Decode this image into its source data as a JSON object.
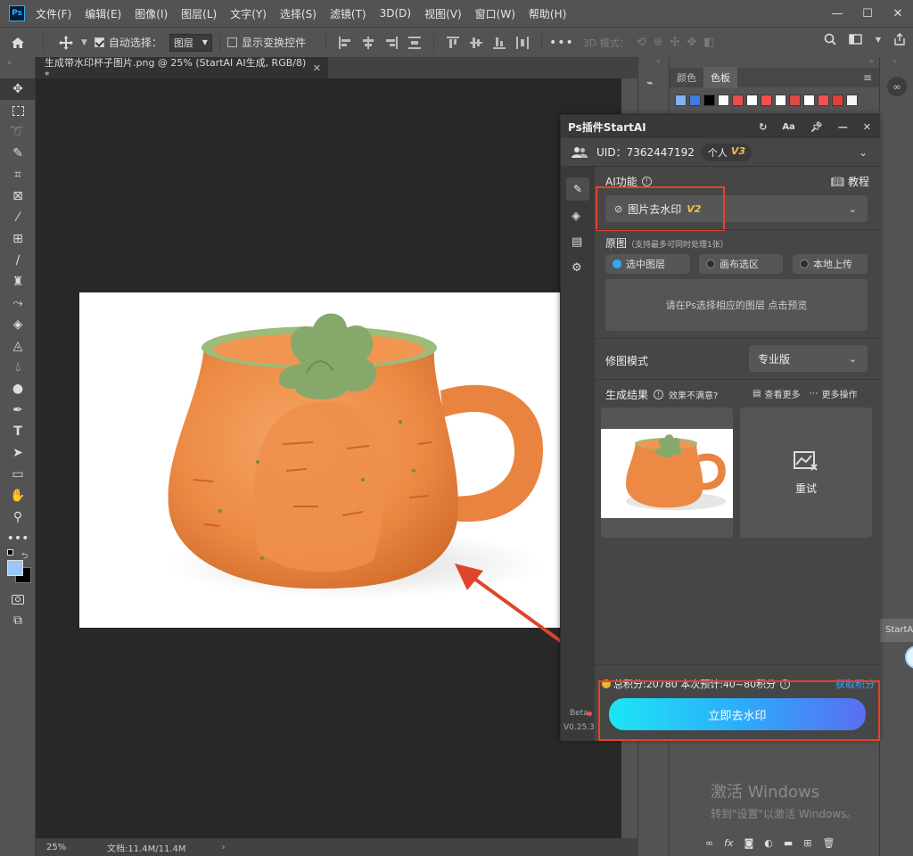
{
  "app": {
    "menu": [
      "文件(F)",
      "编辑(E)",
      "图像(I)",
      "图层(L)",
      "文字(Y)",
      "选择(S)",
      "滤镜(T)",
      "3D(D)",
      "视图(V)",
      "窗口(W)",
      "帮助(H)"
    ],
    "logo": "Ps"
  },
  "options_bar": {
    "auto_select_label": "自动选择：",
    "auto_select_value": "图层",
    "show_transform_label": "显示变换控件",
    "mode3d_label": "3D 模式："
  },
  "document": {
    "tab_title": "生成带水印杯子图片.png @ 25% (StartAI AI生成, RGB/8) *",
    "zoom": "25%",
    "doc_info": "文档:11.4M/11.4M"
  },
  "panels": {
    "tab_color": "颜色",
    "tab_swatches": "色板",
    "swatch_colors": [
      "#7fb3f5",
      "#3f7be0",
      "#000000",
      "#ffffff",
      "#e84c4c",
      "#ffffff",
      "#f05050",
      "#ffffff",
      "#e04848",
      "#ffffff",
      "#f25252",
      "#e23c3c",
      "#f4f4f4"
    ],
    "far_right_label": "StartA"
  },
  "plugin": {
    "title": "Ps插件StartAI",
    "uid": "UID：7362447192",
    "badge_personal": "个人",
    "badge_version": "V3",
    "ai_func_label": "AI功能",
    "tutorial_label": "教程",
    "feature_value": "图片去水印",
    "feature_version": "V2",
    "source_label": "原图",
    "source_hint": "（支持最多可同时处理1张）",
    "radio_options": [
      "选中图层",
      "画布选区",
      "本地上传"
    ],
    "preview_hint": "请在Ps选择相应的图层 点击预览",
    "mode_label": "修图模式",
    "mode_value": "专业版",
    "result_label": "生成结果",
    "unsatisfied_label": "效果不满意?",
    "see_more_label": "查看更多",
    "more_ops_label": "更多操作",
    "retry_label": "重试",
    "points_text": "总积分:20780 本次预计:40~80积分",
    "get_points_label": "获取积分",
    "cta_label": "立即去水印",
    "beta_label": "Beta",
    "version_label": "V0.25.3"
  },
  "watermark": {
    "line1": "激活 Windows",
    "line2": "转到\"设置\"以激活 Windows。"
  }
}
